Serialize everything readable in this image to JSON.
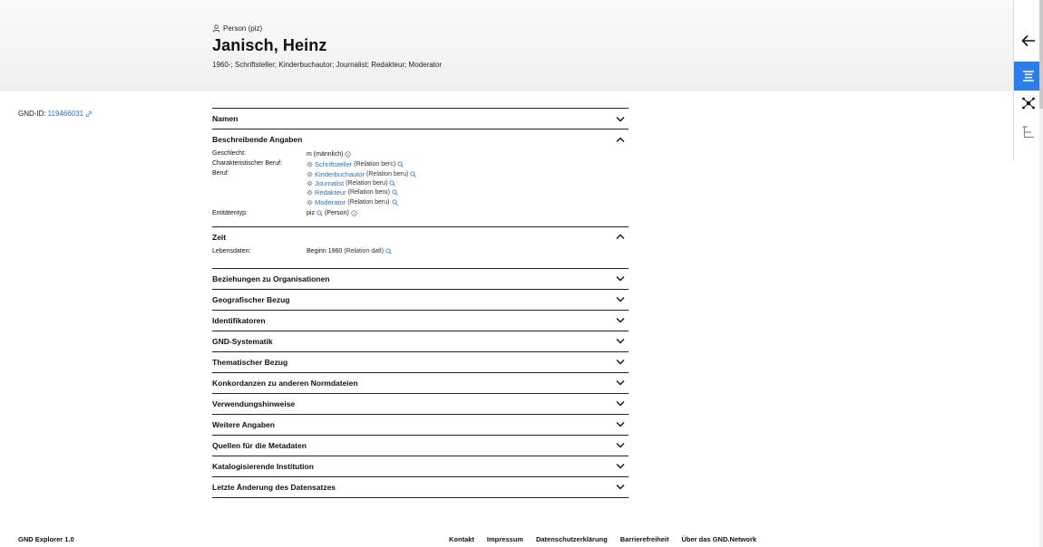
{
  "header": {
    "entity_type": "Person (piz)",
    "title": "Janisch, Heinz",
    "subtitle": "1960-; Schriftsteller; Kinderbuchautor; Journalist; Redakteur; Moderator"
  },
  "gnd": {
    "label": "GND-ID:",
    "id": "119466031"
  },
  "sections": {
    "namen": "Namen",
    "beschreibende": "Beschreibende Angaben",
    "zeit": "Zeit",
    "collapsed": [
      "Beziehungen zu Organisationen",
      "Geografischer Bezug",
      "Identifikatoren",
      "GND-Systematik",
      "Thematischer Bezug",
      "Konkordanzen zu anderen Normdateien",
      "Verwendungshinweise",
      "Weitere Angaben",
      "Quellen für die Metadaten",
      "Katalogisierende Institution",
      "Letzte Änderung des Datensatzes"
    ]
  },
  "beschreibende": {
    "geschlecht_label": "Geschlecht:",
    "geschlecht_value": "m (männlich)",
    "char_beruf_label": "Charakteristischer Beruf:",
    "char_beruf": {
      "link": "Schriftsteller",
      "relation": "(Relation berc)"
    },
    "beruf_label": "Beruf:",
    "berufe": [
      {
        "link": "Kinderbuchautor",
        "relation": "(Relation beru)"
      },
      {
        "link": "Journalist",
        "relation": "(Relation beru)"
      },
      {
        "link": "Redakteur",
        "relation": "(Relation beru)"
      },
      {
        "link": "Moderator",
        "relation": "(Relation beru)"
      }
    ],
    "entitaet_label": "Entitätentyp:",
    "entitaet_code": "piz",
    "entitaet_value": "(Person)"
  },
  "zeit": {
    "lebensdaten_label": "Lebensdaten:",
    "beginn": "Beginn 1960",
    "relation": "(Relation datl)"
  },
  "footer": {
    "version": "GND Explorer 1.0",
    "links": [
      "Kontakt",
      "Impressum",
      "Datenschutzerklärung",
      "Barrierefreiheit",
      "Über das GND.Network"
    ]
  },
  "colors": {
    "accent": "#2b7de9",
    "link": "#2b6fc9"
  },
  "icons": {
    "rail": [
      "arrow-left-icon",
      "list-icon",
      "network-icon",
      "hierarchy-icon"
    ]
  }
}
